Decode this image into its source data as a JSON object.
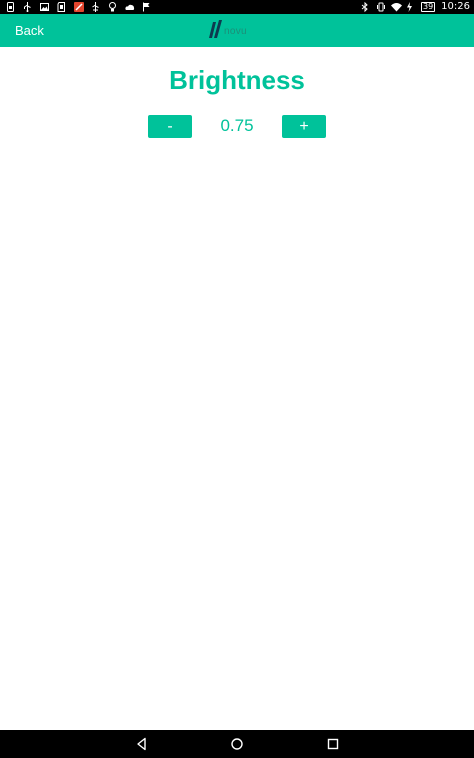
{
  "status_bar": {
    "time": "10:26",
    "battery_percent": "39",
    "left_icons": [
      "sim-icon",
      "usb-icon",
      "image-icon",
      "sd-card-icon",
      "app-notification-icon",
      "usb-debug-icon",
      "bulb-icon",
      "cloud-icon",
      "flag-icon"
    ],
    "right_icons": [
      "bluetooth-icon",
      "vibrate-icon",
      "wifi-icon",
      "battery-charging-icon"
    ]
  },
  "header": {
    "back_label": "Back",
    "logo_text": "novu",
    "background_color": "#00c29a"
  },
  "page": {
    "title": "Brightness",
    "decrement_label": "-",
    "increment_label": "+",
    "value": "0.75",
    "accent_color": "#00c29a"
  },
  "nav_bar": {
    "icons": [
      "nav-back-icon",
      "nav-home-icon",
      "nav-recents-icon"
    ]
  }
}
